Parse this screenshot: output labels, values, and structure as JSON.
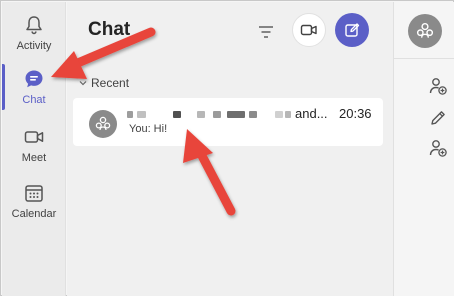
{
  "colors": {
    "accent": "#5b5fc7",
    "arrow": "#e8443a",
    "rail_bg": "#ebebeb",
    "panel_bg": "#f0f0f0",
    "card_bg": "#ffffff"
  },
  "rail": {
    "items": [
      {
        "label": "Activity",
        "icon": "bell-icon"
      },
      {
        "label": "Chat",
        "icon": "chat-icon",
        "active": true
      },
      {
        "label": "Meet",
        "icon": "video-camera-icon"
      },
      {
        "label": "Calendar",
        "icon": "calendar-icon"
      }
    ]
  },
  "panel": {
    "title": "Chat",
    "filter_icon": "filter-icon",
    "video_icon": "video-camera-icon",
    "compose_icon": "compose-icon",
    "section": "Recent"
  },
  "chat": {
    "name_suffix": "and...",
    "time": "20:36",
    "preview": "You: Hi!"
  },
  "right_pane": {
    "icons": [
      "group-avatar-icon",
      "add-person-icon",
      "pencil-icon",
      "add-person-icon"
    ]
  }
}
